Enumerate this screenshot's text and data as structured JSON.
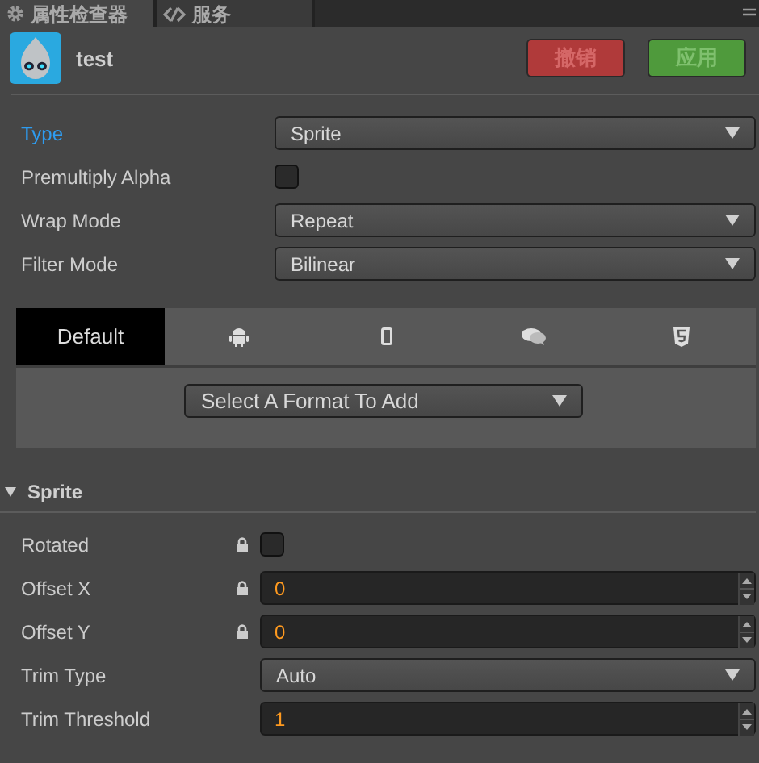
{
  "panel_tabs": [
    {
      "label": "属性检查器",
      "kind": "gear",
      "selected": true
    },
    {
      "label": "服务",
      "kind": "service",
      "selected": false
    }
  ],
  "asset": {
    "name": "test"
  },
  "buttons": [
    {
      "label": "撤销",
      "kind": "revert",
      "disabled": true
    },
    {
      "label": "应用",
      "kind": "apply",
      "disabled": true
    }
  ],
  "properties": [
    {
      "label": "Type",
      "kind": "select",
      "value": "Sprite",
      "selected": true
    },
    {
      "label": "Premultiply Alpha",
      "kind": "checkbox",
      "checked": false,
      "selected": false
    },
    {
      "label": "Wrap Mode",
      "kind": "select",
      "value": "Repeat",
      "selected": false
    },
    {
      "label": "Filter Mode",
      "kind": "select",
      "value": "Bilinear",
      "selected": false
    }
  ],
  "platform_tabs": [
    {
      "kind": "default",
      "label": "Default",
      "selected": true
    },
    {
      "kind": "android",
      "selected": false
    },
    {
      "kind": "mobile",
      "selected": false
    },
    {
      "kind": "chat",
      "selected": false
    },
    {
      "kind": "html5",
      "selected": false
    }
  ],
  "format_select": {
    "value": "Select A Format To Add"
  },
  "sprite_section": {
    "title": "Sprite",
    "expanded": true,
    "rows": [
      {
        "label": "Rotated",
        "kind": "checkbox",
        "checked": false,
        "locked": true
      },
      {
        "label": "Offset X",
        "kind": "number",
        "value": "0",
        "locked": true
      },
      {
        "label": "Offset Y",
        "kind": "number",
        "value": "0",
        "locked": true
      },
      {
        "label": "Trim Type",
        "kind": "select",
        "value": "Auto",
        "locked": false
      },
      {
        "label": "Trim Threshold",
        "kind": "number",
        "value": "1",
        "locked": false
      }
    ]
  }
}
